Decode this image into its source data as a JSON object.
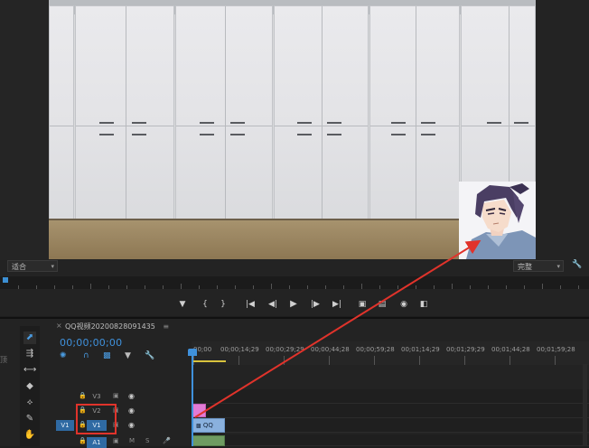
{
  "monitor": {
    "fit_dropdown": "适合",
    "quality_dropdown": "完整",
    "wrench_icon": "wrench-icon",
    "transport": {
      "marker_in": "add-marker-icon",
      "mark_in": "{",
      "mark_out": "}",
      "go_to_in": "go-to-in-icon",
      "step_back": "step-back-icon",
      "play": "play-icon",
      "step_forward": "step-forward-icon",
      "go_to_out": "go-to-out-icon",
      "lift": "lift-icon",
      "extract": "extract-icon",
      "export_frame": "camera-icon",
      "compare": "compare-icon"
    }
  },
  "timeline": {
    "side_panel_text": "顶",
    "sequence_name": "QQ视频20200828091435",
    "timecode": "00;00;00;00",
    "ruler_labels": [
      "00;00",
      "00;00;14;29",
      "00;00;29;29",
      "00;00;44;28",
      "00;00;59;28",
      "00;01;14;29",
      "00;01;29;29",
      "00;01;44;28",
      "00;01;59;28"
    ],
    "tracks": [
      {
        "label": "V3",
        "targeted": false
      },
      {
        "label": "V2",
        "targeted": false
      },
      {
        "label": "V1",
        "targeted": true,
        "source": "V1"
      },
      {
        "label": "A1",
        "targeted": true,
        "m": "M",
        "s": "S"
      }
    ],
    "clips": {
      "v1_name": "QQ"
    }
  },
  "colors": {
    "accent_blue": "#3f91dc",
    "clip_pink": "#e27bd5",
    "clip_blue": "#8ab1de",
    "annotation_red": "#e0332b",
    "work_area": "#d8c33d"
  }
}
